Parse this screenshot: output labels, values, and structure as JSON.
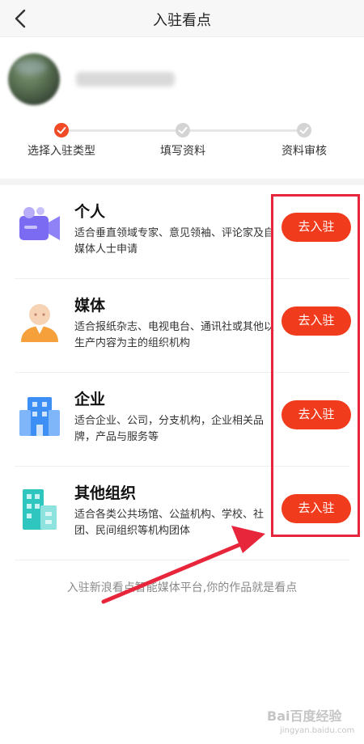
{
  "header": {
    "title": "入驻看点",
    "back_icon": "chevron-left-icon"
  },
  "steps": [
    {
      "label": "选择入驻类型",
      "state": "active"
    },
    {
      "label": "填写资料",
      "state": "inactive"
    },
    {
      "label": "资料审核",
      "state": "inactive"
    }
  ],
  "types": [
    {
      "title": "个人",
      "desc": "适合垂直领域专家、意见领袖、评论家及自媒体人士申请",
      "button": "去入驻",
      "icon": "video-camera-icon"
    },
    {
      "title": "媒体",
      "desc": "适合报纸杂志、电视电台、通讯社或其他以生产内容为主的组织机构",
      "button": "去入驻",
      "icon": "person-icon"
    },
    {
      "title": "企业",
      "desc": "适合企业、公司，分支机构，企业相关品牌，产品与服务等",
      "button": "去入驻",
      "icon": "building-icon"
    },
    {
      "title": "其他组织",
      "desc": "适合各类公共场馆、公益机构、学校、社团、民间组织等机构团体",
      "button": "去入驻",
      "icon": "office-buildings-icon"
    }
  ],
  "footer": {
    "note": "入驻新浪看点智能媒体平台,你的作品就是看点"
  },
  "watermark": {
    "text": "Bai百度经验",
    "sub": "jingyan.baidu.com"
  },
  "colors": {
    "accent": "#f13b1d",
    "highlight": "#e8263b"
  }
}
